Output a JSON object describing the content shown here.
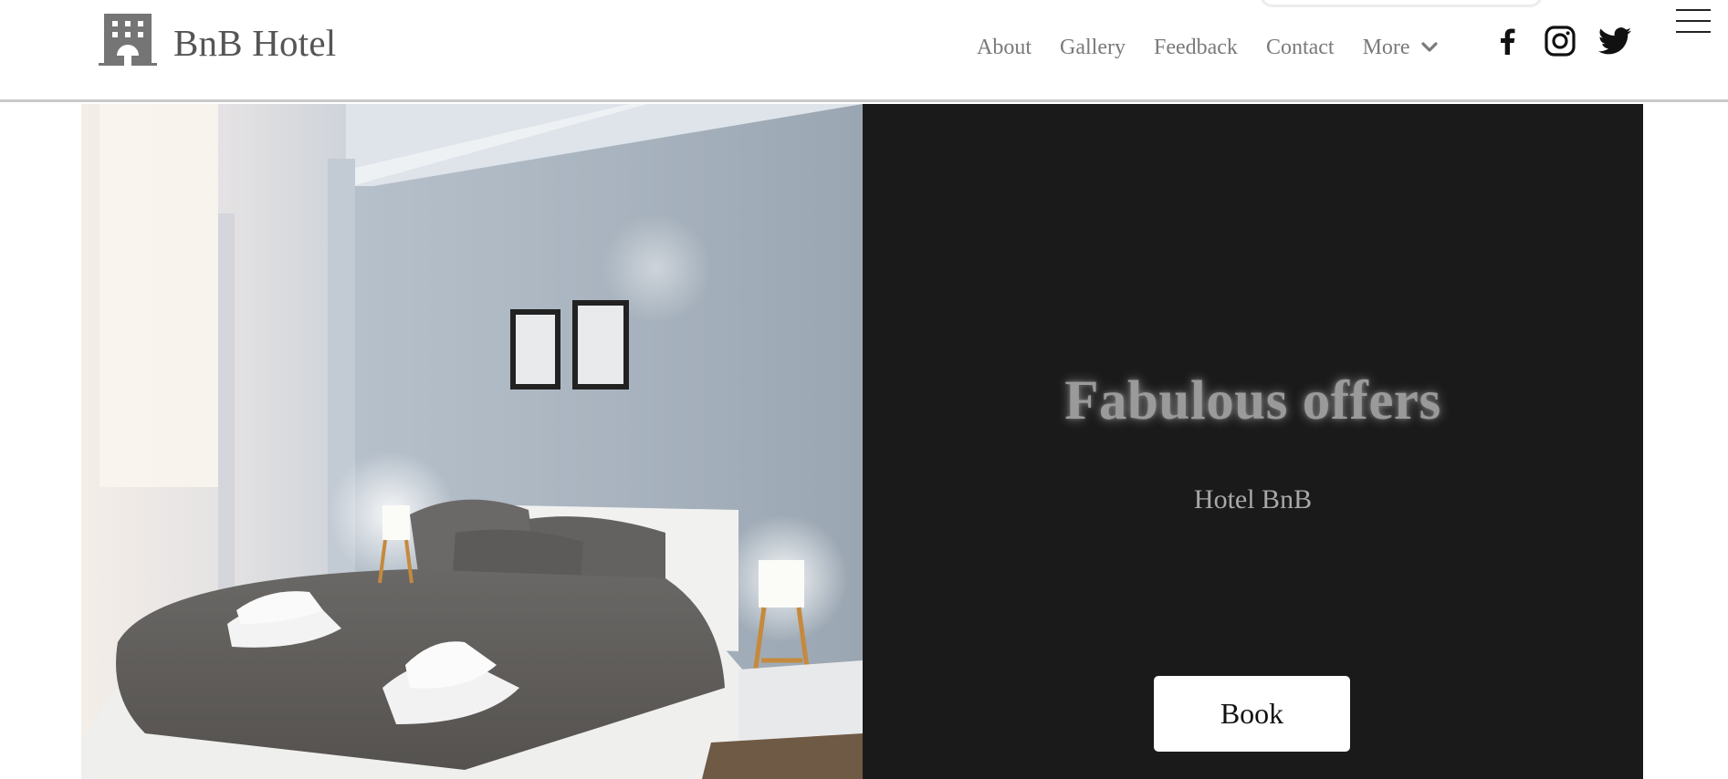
{
  "brand": {
    "name": "BnB Hotel",
    "logo_icon": "hotel-building-icon",
    "logo_color": "#757575"
  },
  "nav": {
    "items": [
      {
        "label": "About"
      },
      {
        "label": "Gallery"
      },
      {
        "label": "Feedback"
      },
      {
        "label": "Contact"
      }
    ],
    "more_label": "More",
    "more_icon": "chevron-down-icon"
  },
  "social": {
    "icons": [
      "facebook-icon",
      "instagram-icon",
      "twitter-icon"
    ]
  },
  "menu_icon": "hamburger-menu-icon",
  "hero": {
    "title": "Fabulous offers",
    "subtitle": "Hotel BnB",
    "book_label": "Book",
    "panel_color": "#1a1a1a",
    "image_subject": "hotel-bedroom-photo"
  }
}
